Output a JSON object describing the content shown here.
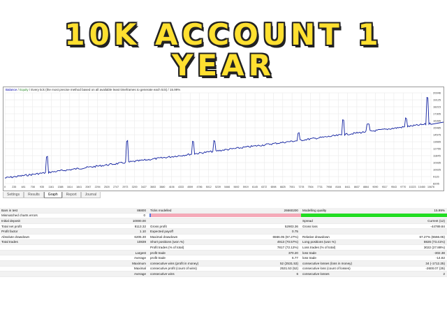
{
  "title": {
    "line1": "10K ACCOUNT 1",
    "line2": "YEAR"
  },
  "chart": {
    "header_balance": "Balance",
    "header_sep": "/",
    "header_equity": "Equity",
    "header_rest": "/ Every tick (the most precise method based on all available least timeframes to generate each tick) / 15.99%",
    "y_ticks": [
      "20046",
      "19125",
      "18215",
      "17305",
      "16395",
      "15485",
      "14575",
      "13665",
      "12755",
      "11845",
      "10935",
      "10025",
      "9115",
      "8205"
    ],
    "x_ticks": [
      "0",
      "235",
      "481",
      "708",
      "935",
      "1161",
      "1388",
      "1614",
      "1841",
      "2067",
      "2294",
      "2520",
      "2747",
      "2973",
      "3200",
      "3427",
      "3653",
      "3880",
      "4106",
      "4333",
      "4559",
      "4786",
      "5012",
      "5239",
      "5466",
      "5692",
      "5919",
      "6145",
      "6372",
      "6598",
      "6825",
      "7051",
      "7278",
      "7504",
      "7731",
      "7958",
      "8184",
      "8411",
      "8637",
      "8864",
      "9090",
      "9317",
      "9543",
      "9770",
      "10223",
      "10450",
      "10676"
    ],
    "colors": {
      "balance": "#1020a0",
      "grid": "#e6e6e6"
    }
  },
  "tabs": [
    {
      "label": "Settings",
      "active": false
    },
    {
      "label": "Results",
      "active": false
    },
    {
      "label": "Graph",
      "active": true
    },
    {
      "label": "Report",
      "active": false
    },
    {
      "label": "Journal",
      "active": false
    }
  ],
  "stats": {
    "bars_label": "Bars in test",
    "bars_value": "86800",
    "ticks_label": "Ticks modelled",
    "ticks_value": "26660200",
    "mq_label": "Modelling quality",
    "mq_value": "15.99%",
    "mismatch_label": "Mismatched charts errors",
    "mismatch_value": "0",
    "r3": [
      "Initial deposit",
      "10000.00",
      "",
      "",
      "Spread",
      "Current (12)"
    ],
    "r4": [
      "Total net profit",
      "8113.32",
      "Gross profit",
      "52903.36",
      "Gross loss",
      "-44789.84"
    ],
    "r5": [
      "Profit factor",
      "1.10",
      "Expected payoff",
      "0.75",
      "",
      ""
    ],
    "r6": [
      "Absolute drawdown",
      "6205.30",
      "Maximal drawdown",
      "6566.05 (67.27%)",
      "Relative drawdown",
      "67.27% (6566.05)"
    ],
    "r7": [
      "Total trades",
      "10839",
      "Short positions (won %)",
      "4913 (70.57%)",
      "Long positions (won %)",
      "5926 (73.41%)"
    ],
    "r8": [
      "",
      "",
      "Profit trades (% of total)",
      "7817 (72.12%)",
      "Loss trades (% of total)",
      "3022 (27.88%)"
    ],
    "r9": [
      "Largest",
      "profit trade",
      "370.20",
      "loss trade",
      "-302.38"
    ],
    "r10": [
      "Average",
      "profit trade",
      "6.77",
      "loss trade",
      "-14.82"
    ],
    "r11": [
      "Maximum",
      "consecutive wins (profit in money)",
      "52 (2531.53)",
      "consecutive losses (loss in money)",
      "34 (-1712.25)"
    ],
    "r12": [
      "Maximal",
      "consecutive profit (count of wins)",
      "2531.53 (52)",
      "consecutive loss (count of losses)",
      "-2600.07 (25)"
    ],
    "r13": [
      "Average",
      "consecutive wins",
      "6",
      "consecutive losses",
      "2"
    ]
  }
}
